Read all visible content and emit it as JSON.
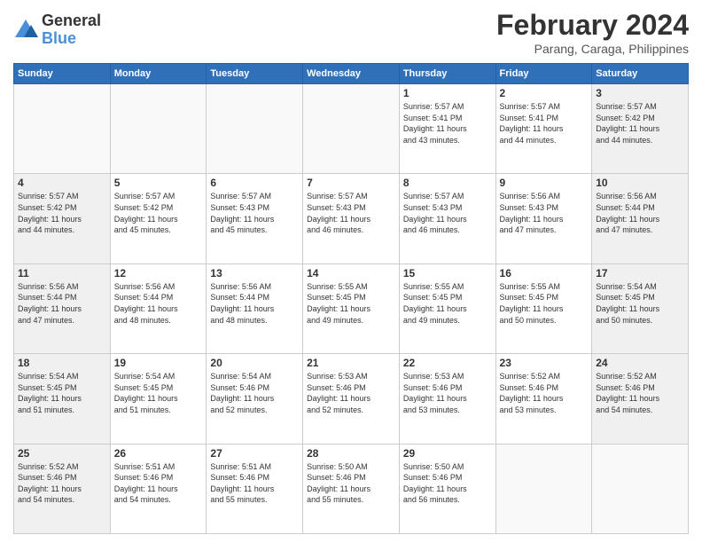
{
  "header": {
    "logo_line1": "General",
    "logo_line2": "Blue",
    "month": "February 2024",
    "location": "Parang, Caraga, Philippines"
  },
  "days_of_week": [
    "Sunday",
    "Monday",
    "Tuesday",
    "Wednesday",
    "Thursday",
    "Friday",
    "Saturday"
  ],
  "weeks": [
    [
      {
        "day": "",
        "info": "",
        "empty": true
      },
      {
        "day": "",
        "info": "",
        "empty": true
      },
      {
        "day": "",
        "info": "",
        "empty": true
      },
      {
        "day": "",
        "info": "",
        "empty": true
      },
      {
        "day": "1",
        "info": "Sunrise: 5:57 AM\nSunset: 5:41 PM\nDaylight: 11 hours\nand 43 minutes."
      },
      {
        "day": "2",
        "info": "Sunrise: 5:57 AM\nSunset: 5:41 PM\nDaylight: 11 hours\nand 44 minutes."
      },
      {
        "day": "3",
        "info": "Sunrise: 5:57 AM\nSunset: 5:42 PM\nDaylight: 11 hours\nand 44 minutes."
      }
    ],
    [
      {
        "day": "4",
        "info": "Sunrise: 5:57 AM\nSunset: 5:42 PM\nDaylight: 11 hours\nand 44 minutes."
      },
      {
        "day": "5",
        "info": "Sunrise: 5:57 AM\nSunset: 5:42 PM\nDaylight: 11 hours\nand 45 minutes."
      },
      {
        "day": "6",
        "info": "Sunrise: 5:57 AM\nSunset: 5:43 PM\nDaylight: 11 hours\nand 45 minutes."
      },
      {
        "day": "7",
        "info": "Sunrise: 5:57 AM\nSunset: 5:43 PM\nDaylight: 11 hours\nand 46 minutes."
      },
      {
        "day": "8",
        "info": "Sunrise: 5:57 AM\nSunset: 5:43 PM\nDaylight: 11 hours\nand 46 minutes."
      },
      {
        "day": "9",
        "info": "Sunrise: 5:56 AM\nSunset: 5:43 PM\nDaylight: 11 hours\nand 47 minutes."
      },
      {
        "day": "10",
        "info": "Sunrise: 5:56 AM\nSunset: 5:44 PM\nDaylight: 11 hours\nand 47 minutes."
      }
    ],
    [
      {
        "day": "11",
        "info": "Sunrise: 5:56 AM\nSunset: 5:44 PM\nDaylight: 11 hours\nand 47 minutes."
      },
      {
        "day": "12",
        "info": "Sunrise: 5:56 AM\nSunset: 5:44 PM\nDaylight: 11 hours\nand 48 minutes."
      },
      {
        "day": "13",
        "info": "Sunrise: 5:56 AM\nSunset: 5:44 PM\nDaylight: 11 hours\nand 48 minutes."
      },
      {
        "day": "14",
        "info": "Sunrise: 5:55 AM\nSunset: 5:45 PM\nDaylight: 11 hours\nand 49 minutes."
      },
      {
        "day": "15",
        "info": "Sunrise: 5:55 AM\nSunset: 5:45 PM\nDaylight: 11 hours\nand 49 minutes."
      },
      {
        "day": "16",
        "info": "Sunrise: 5:55 AM\nSunset: 5:45 PM\nDaylight: 11 hours\nand 50 minutes."
      },
      {
        "day": "17",
        "info": "Sunrise: 5:54 AM\nSunset: 5:45 PM\nDaylight: 11 hours\nand 50 minutes."
      }
    ],
    [
      {
        "day": "18",
        "info": "Sunrise: 5:54 AM\nSunset: 5:45 PM\nDaylight: 11 hours\nand 51 minutes."
      },
      {
        "day": "19",
        "info": "Sunrise: 5:54 AM\nSunset: 5:45 PM\nDaylight: 11 hours\nand 51 minutes."
      },
      {
        "day": "20",
        "info": "Sunrise: 5:54 AM\nSunset: 5:46 PM\nDaylight: 11 hours\nand 52 minutes."
      },
      {
        "day": "21",
        "info": "Sunrise: 5:53 AM\nSunset: 5:46 PM\nDaylight: 11 hours\nand 52 minutes."
      },
      {
        "day": "22",
        "info": "Sunrise: 5:53 AM\nSunset: 5:46 PM\nDaylight: 11 hours\nand 53 minutes."
      },
      {
        "day": "23",
        "info": "Sunrise: 5:52 AM\nSunset: 5:46 PM\nDaylight: 11 hours\nand 53 minutes."
      },
      {
        "day": "24",
        "info": "Sunrise: 5:52 AM\nSunset: 5:46 PM\nDaylight: 11 hours\nand 54 minutes."
      }
    ],
    [
      {
        "day": "25",
        "info": "Sunrise: 5:52 AM\nSunset: 5:46 PM\nDaylight: 11 hours\nand 54 minutes."
      },
      {
        "day": "26",
        "info": "Sunrise: 5:51 AM\nSunset: 5:46 PM\nDaylight: 11 hours\nand 54 minutes."
      },
      {
        "day": "27",
        "info": "Sunrise: 5:51 AM\nSunset: 5:46 PM\nDaylight: 11 hours\nand 55 minutes."
      },
      {
        "day": "28",
        "info": "Sunrise: 5:50 AM\nSunset: 5:46 PM\nDaylight: 11 hours\nand 55 minutes."
      },
      {
        "day": "29",
        "info": "Sunrise: 5:50 AM\nSunset: 5:46 PM\nDaylight: 11 hours\nand 56 minutes."
      },
      {
        "day": "",
        "info": "",
        "empty": true
      },
      {
        "day": "",
        "info": "",
        "empty": true
      }
    ]
  ]
}
